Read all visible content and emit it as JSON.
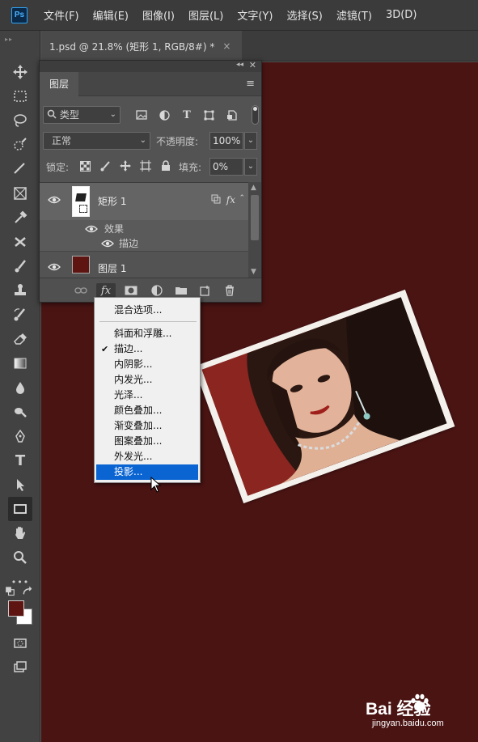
{
  "menubar": {
    "logo_text": "Ps",
    "items": [
      "文件(F)",
      "编辑(E)",
      "图像(I)",
      "图层(L)",
      "文字(Y)",
      "选择(S)",
      "滤镜(T)",
      "3D(D)"
    ]
  },
  "document_tab": {
    "title": "1.psd @ 21.8% (矩形 1, RGB/8#) *",
    "close": "×"
  },
  "toolbar": {
    "grip": "▸▸",
    "tools": [
      "move-tool",
      "marquee-tool",
      "lasso-tool",
      "quick-select-tool",
      "crop-tool",
      "frame-tool",
      "eyedropper-tool",
      "healing-tool",
      "brush-tool",
      "stamp-tool",
      "history-brush-tool",
      "eraser-tool",
      "gradient-tool",
      "blur-tool",
      "dodge-tool",
      "pen-tool",
      "type-tool",
      "path-select-tool",
      "rectangle-tool",
      "hand-tool",
      "zoom-tool",
      "more-tools",
      "default-colors",
      "quick-mask",
      "screen-mode"
    ],
    "active_tool": "rectangle-tool",
    "type_tool_glyph": "T",
    "more_glyph": "•••",
    "foreground_color": "#5e1410",
    "background_color": "#ffffff"
  },
  "layers_panel": {
    "topbar": {
      "collapse": "◂◂",
      "close": "✕"
    },
    "title": "图层",
    "menu_icon": "≡",
    "filter_label": "类型",
    "filter_icons": [
      "image-filter-icon",
      "adjustment-filter-icon",
      "type-filter-icon",
      "shape-filter-icon",
      "smartobject-filter-icon"
    ],
    "type_filter_glyph": "T",
    "blend_mode": "正常",
    "opacity_label": "不透明度:",
    "opacity_value": "100%",
    "lock_label": "锁定:",
    "fill_label": "填充:",
    "fill_value": "0%",
    "layers": [
      {
        "name": "矩形 1",
        "fx": "fx",
        "effects_label": "效果",
        "effect": "描边"
      },
      {
        "name": "图层 1"
      }
    ],
    "footer_fx": "fx"
  },
  "fx_menu": {
    "blending": "混合选项...",
    "items": [
      {
        "label": "斜面和浮雕...",
        "checked": false
      },
      {
        "label": "描边...",
        "checked": true
      },
      {
        "label": "内阴影...",
        "checked": false
      },
      {
        "label": "内发光...",
        "checked": false
      },
      {
        "label": "光泽...",
        "checked": false
      },
      {
        "label": "颜色叠加...",
        "checked": false
      },
      {
        "label": "渐变叠加...",
        "checked": false
      },
      {
        "label": "图案叠加...",
        "checked": false
      },
      {
        "label": "外发光...",
        "checked": false
      },
      {
        "label": "投影...",
        "checked": false,
        "highlighted": true
      }
    ],
    "check_glyph": "✔"
  },
  "canvas": {
    "background": "#4a1413"
  },
  "watermark": {
    "main": "Bai  经验",
    "sub": "jingyan.baidu.com"
  }
}
